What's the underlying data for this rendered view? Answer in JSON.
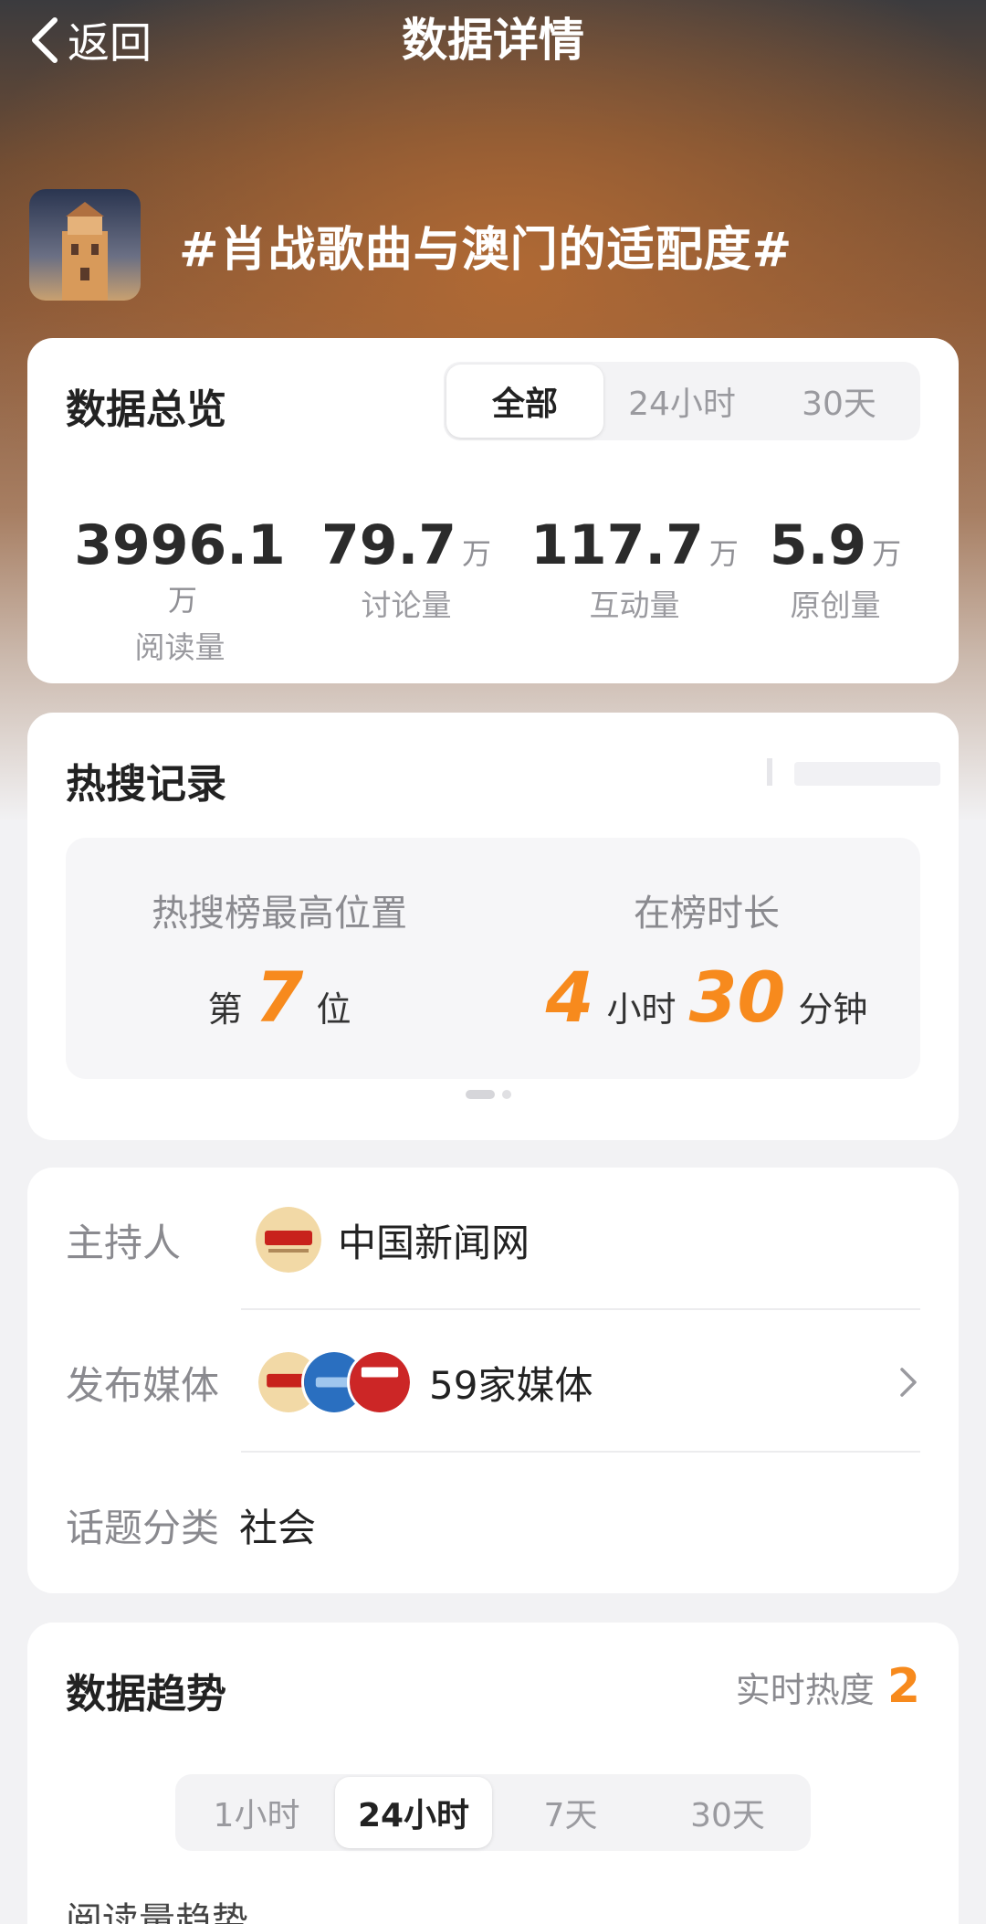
{
  "header": {
    "back_label": "返回",
    "title": "数据详情"
  },
  "topic": {
    "title": "#肖战歌曲与澳门的适配度#"
  },
  "overview": {
    "title": "数据总览",
    "tabs": [
      "全部",
      "24小时",
      "30天"
    ],
    "active_tab": "全部",
    "stats": [
      {
        "value": "3996.1",
        "unit": "万",
        "label": "阅读量"
      },
      {
        "value": "79.7",
        "unit": "万",
        "label": "讨论量"
      },
      {
        "value": "117.7",
        "unit": "万",
        "label": "互动量"
      },
      {
        "value": "5.9",
        "unit": "万",
        "label": "原创量"
      }
    ]
  },
  "hot_search": {
    "title": "热搜记录",
    "highest_position": {
      "label": "热搜榜最高位置",
      "prefix": "第",
      "value": "7",
      "suffix": "位"
    },
    "duration": {
      "label": "在榜时长",
      "hours": "4",
      "hours_unit": "小时",
      "minutes": "30",
      "minutes_unit": "分钟"
    }
  },
  "info": {
    "host_label": "主持人",
    "host_name": "中国新闻网",
    "media_label": "发布媒体",
    "media_count": "59家媒体",
    "category_label": "话题分类",
    "category_value": "社会"
  },
  "trend": {
    "title": "数据趋势",
    "heat_label": "实时热度",
    "heat_value": "2",
    "tabs": [
      "1小时",
      "24小时",
      "7天",
      "30天"
    ],
    "active_tab": "24小时",
    "subtitle": "阅读量趋势"
  },
  "colors": {
    "accent": "#f78a1d",
    "card": "#ffffff",
    "page_bg": "#f2f2f4"
  },
  "icons": [
    "back-chevron-icon",
    "chevron-right-icon"
  ]
}
